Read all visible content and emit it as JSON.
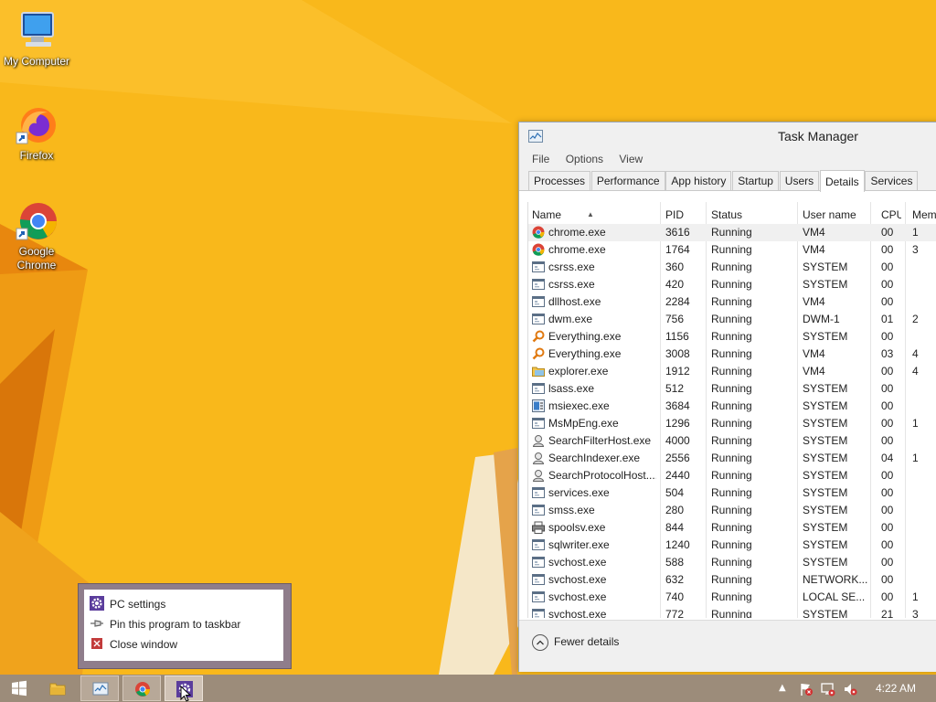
{
  "desktop": {
    "icons": [
      {
        "label": "My Computer",
        "icon": "computer-icon"
      },
      {
        "label": "Firefox",
        "icon": "firefox-icon"
      },
      {
        "label": "Google Chrome",
        "icon": "chrome-icon"
      }
    ]
  },
  "task_manager": {
    "title": "Task Manager",
    "menu": [
      "File",
      "Options",
      "View"
    ],
    "tabs": [
      "Processes",
      "Performance",
      "App history",
      "Startup",
      "Users",
      "Details",
      "Services"
    ],
    "active_tab": "Details",
    "columns": {
      "name": "Name",
      "pid": "PID",
      "status": "Status",
      "user": "User name",
      "cpu": "CPU",
      "mem": "Mem"
    },
    "rows": [
      {
        "name": "chrome.exe",
        "pid": "3616",
        "status": "Running",
        "user": "VM4",
        "cpu": "00",
        "mem": "1",
        "icon": "chrome-icon"
      },
      {
        "name": "chrome.exe",
        "pid": "1764",
        "status": "Running",
        "user": "VM4",
        "cpu": "00",
        "mem": "3",
        "icon": "chrome-icon"
      },
      {
        "name": "csrss.exe",
        "pid": "360",
        "status": "Running",
        "user": "SYSTEM",
        "cpu": "00",
        "mem": "",
        "icon": "window-icon"
      },
      {
        "name": "csrss.exe",
        "pid": "420",
        "status": "Running",
        "user": "SYSTEM",
        "cpu": "00",
        "mem": "",
        "icon": "window-icon"
      },
      {
        "name": "dllhost.exe",
        "pid": "2284",
        "status": "Running",
        "user": "VM4",
        "cpu": "00",
        "mem": "",
        "icon": "window-icon"
      },
      {
        "name": "dwm.exe",
        "pid": "756",
        "status": "Running",
        "user": "DWM-1",
        "cpu": "01",
        "mem": "2",
        "icon": "window-icon"
      },
      {
        "name": "Everything.exe",
        "pid": "1156",
        "status": "Running",
        "user": "SYSTEM",
        "cpu": "00",
        "mem": "",
        "icon": "magnifier-icon"
      },
      {
        "name": "Everything.exe",
        "pid": "3008",
        "status": "Running",
        "user": "VM4",
        "cpu": "03",
        "mem": "4",
        "icon": "magnifier-icon"
      },
      {
        "name": "explorer.exe",
        "pid": "1912",
        "status": "Running",
        "user": "VM4",
        "cpu": "00",
        "mem": "4",
        "icon": "folder-icon"
      },
      {
        "name": "lsass.exe",
        "pid": "512",
        "status": "Running",
        "user": "SYSTEM",
        "cpu": "00",
        "mem": "",
        "icon": "window-icon"
      },
      {
        "name": "msiexec.exe",
        "pid": "3684",
        "status": "Running",
        "user": "SYSTEM",
        "cpu": "00",
        "mem": "",
        "icon": "installer-icon"
      },
      {
        "name": "MsMpEng.exe",
        "pid": "1296",
        "status": "Running",
        "user": "SYSTEM",
        "cpu": "00",
        "mem": "1",
        "icon": "window-icon"
      },
      {
        "name": "SearchFilterHost.exe",
        "pid": "4000",
        "status": "Running",
        "user": "SYSTEM",
        "cpu": "00",
        "mem": "",
        "icon": "search-user-icon"
      },
      {
        "name": "SearchIndexer.exe",
        "pid": "2556",
        "status": "Running",
        "user": "SYSTEM",
        "cpu": "04",
        "mem": "1",
        "icon": "search-user-icon"
      },
      {
        "name": "SearchProtocolHost....",
        "pid": "2440",
        "status": "Running",
        "user": "SYSTEM",
        "cpu": "00",
        "mem": "",
        "icon": "search-user-icon"
      },
      {
        "name": "services.exe",
        "pid": "504",
        "status": "Running",
        "user": "SYSTEM",
        "cpu": "00",
        "mem": "",
        "icon": "window-icon"
      },
      {
        "name": "smss.exe",
        "pid": "280",
        "status": "Running",
        "user": "SYSTEM",
        "cpu": "00",
        "mem": "",
        "icon": "window-icon"
      },
      {
        "name": "spoolsv.exe",
        "pid": "844",
        "status": "Running",
        "user": "SYSTEM",
        "cpu": "00",
        "mem": "",
        "icon": "printer-icon"
      },
      {
        "name": "sqlwriter.exe",
        "pid": "1240",
        "status": "Running",
        "user": "SYSTEM",
        "cpu": "00",
        "mem": "",
        "icon": "window-icon"
      },
      {
        "name": "svchost.exe",
        "pid": "588",
        "status": "Running",
        "user": "SYSTEM",
        "cpu": "00",
        "mem": "",
        "icon": "window-icon"
      },
      {
        "name": "svchost.exe",
        "pid": "632",
        "status": "Running",
        "user": "NETWORK...",
        "cpu": "00",
        "mem": "",
        "icon": "window-icon"
      },
      {
        "name": "svchost.exe",
        "pid": "740",
        "status": "Running",
        "user": "LOCAL SE...",
        "cpu": "00",
        "mem": "1",
        "icon": "window-icon"
      },
      {
        "name": "svchost.exe",
        "pid": "772",
        "status": "Running",
        "user": "SYSTEM",
        "cpu": "21",
        "mem": "3",
        "icon": "window-icon"
      }
    ],
    "footer": {
      "fewer_details": "Fewer details"
    }
  },
  "jump_list": {
    "items": [
      {
        "label": "PC settings",
        "icon": "gear-icon"
      },
      {
        "label": "Pin this program to taskbar",
        "icon": "pin-icon"
      },
      {
        "label": "Close window",
        "icon": "close-icon"
      }
    ]
  },
  "taskbar": {
    "buttons": [
      "start-icon",
      "file-explorer-icon",
      "task-manager-icon",
      "chrome-icon",
      "pc-settings-icon"
    ],
    "clock": "4:22 AM"
  },
  "colors": {
    "wallpaper": "#f9b81b",
    "taskbar": "#9c8c7a",
    "jumplist_frame": "#8f7d8b"
  }
}
